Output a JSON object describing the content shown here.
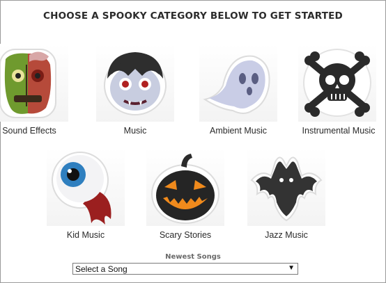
{
  "heading": "CHOOSE A SPOOKY CATEGORY BELOW TO GET STARTED",
  "categories": [
    {
      "label": "Sound Effects",
      "icon": "zombie-icon"
    },
    {
      "label": "Music",
      "icon": "vampire-icon"
    },
    {
      "label": "Ambient Music",
      "icon": "ghost-icon"
    },
    {
      "label": "Instrumental Music",
      "icon": "skull-crossbones-icon"
    },
    {
      "label": "Kid Music",
      "icon": "eyeball-icon"
    },
    {
      "label": "Scary Stories",
      "icon": "jack-o-lantern-icon"
    },
    {
      "label": "Jazz Music",
      "icon": "demon-bat-icon"
    }
  ],
  "newest": {
    "label": "Newest Songs",
    "select_value": "Select a Song"
  }
}
